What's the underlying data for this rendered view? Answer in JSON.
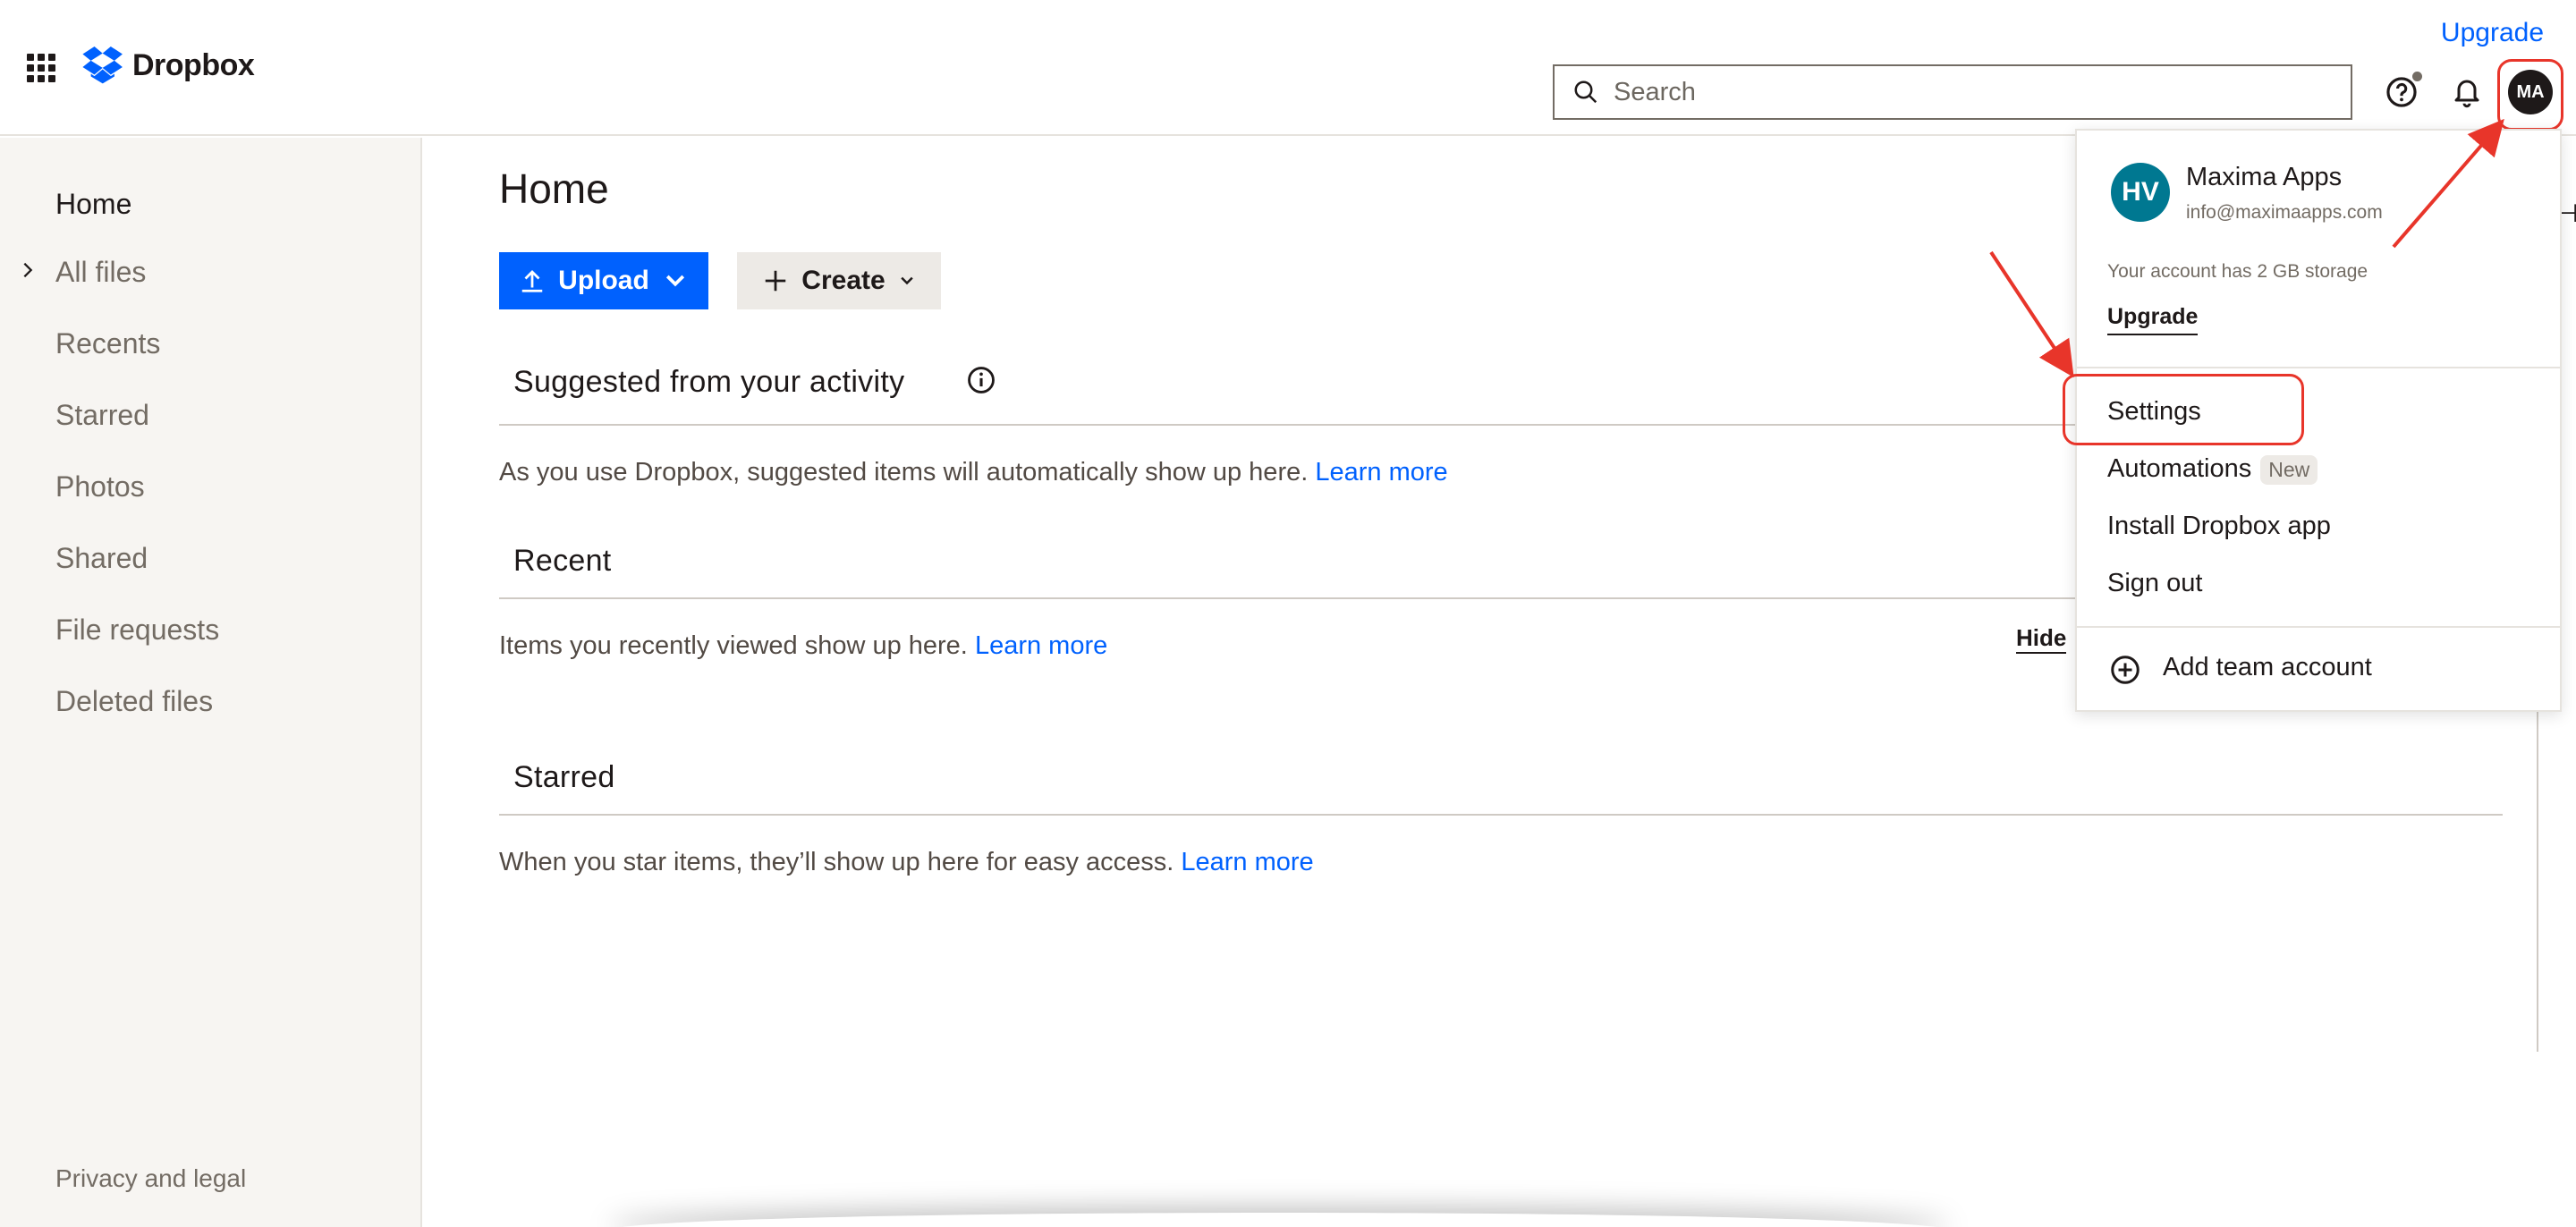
{
  "header": {
    "brand": "Dropbox",
    "upgrade": "Upgrade",
    "search_placeholder": "Search",
    "avatar_initials": "MA",
    "icons": [
      "app-grid-icon",
      "dropbox-logo-icon",
      "search-icon",
      "help-icon",
      "bell-icon"
    ]
  },
  "sidebar": {
    "items": [
      {
        "label": "Home"
      },
      {
        "label": "All files"
      },
      {
        "label": "Recents"
      },
      {
        "label": "Starred"
      },
      {
        "label": "Photos"
      },
      {
        "label": "Shared"
      },
      {
        "label": "File requests"
      },
      {
        "label": "Deleted files"
      }
    ],
    "footer": "Privacy and legal"
  },
  "main": {
    "title": "Home",
    "upload_label": "Upload",
    "create_label": "Create",
    "sections": [
      {
        "title": "Suggested from your activity",
        "text": "As you use Dropbox, suggested items will automatically show up here.",
        "link": "Learn more"
      },
      {
        "title": "Recent",
        "text": "Items you recently viewed show up here.",
        "link": "Learn more"
      },
      {
        "title": "Starred",
        "text": "When you star items, they’ll show up here for easy access.",
        "link": "Learn more",
        "action": "Hide"
      }
    ]
  },
  "account_menu": {
    "avatar_initials": "HV",
    "name": "Maxima Apps",
    "email": "info@maximaapps.com",
    "storage_text": "Your account has 2 GB storage",
    "upgrade_label": "Upgrade",
    "items": [
      {
        "label": "Settings"
      },
      {
        "label": "Automations",
        "badge": "New"
      },
      {
        "label": "Install Dropbox app"
      },
      {
        "label": "Sign out"
      }
    ],
    "add_team": "Add team account"
  },
  "colors": {
    "accent": "#0061fe",
    "annotation": "#e8352a",
    "menu_avatar": "#007891"
  }
}
